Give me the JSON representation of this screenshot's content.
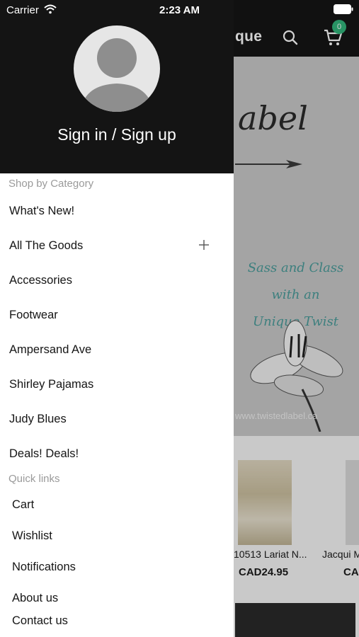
{
  "status_bar": {
    "carrier": "Carrier",
    "time": "2:23 AM"
  },
  "background_app": {
    "title_fragment": "que",
    "cart_count": "0",
    "hero": {
      "script_text": "abel",
      "tagline_lines": [
        "Sass and Class",
        "with an",
        "Unique Twist"
      ],
      "url_text": "www.twistedlabel.ca"
    },
    "products": [
      {
        "name": "10513 Lariat N...",
        "price": "CAD24.95"
      },
      {
        "name": "Jacqui M",
        "price": "CA"
      }
    ]
  },
  "drawer": {
    "sign_in_label": "Sign in / Sign up",
    "shop_section_label": "Shop by Category",
    "categories": [
      {
        "label": "What's New!"
      },
      {
        "label": "All The Goods",
        "expandable": true
      },
      {
        "label": "Accessories"
      },
      {
        "label": "Footwear"
      },
      {
        "label": "Ampersand Ave"
      },
      {
        "label": "Shirley Pajamas"
      },
      {
        "label": "Judy Blues"
      },
      {
        "label": "Deals! Deals!"
      }
    ],
    "quick_section_label": "Quick links",
    "quick_links": [
      {
        "label": "Cart"
      },
      {
        "label": "Wishlist"
      },
      {
        "label": "Notifications"
      },
      {
        "label": "About us"
      },
      {
        "label": "Contact us"
      }
    ]
  },
  "colors": {
    "header_bg": "#141414",
    "accent_badge": "#31b47a",
    "section_label": "#9a9a9a",
    "tagline": "#4a9c9a"
  },
  "icons": {
    "search": "search-icon",
    "cart": "cart-icon",
    "expand": "plus-icon",
    "avatar": "user-avatar-icon",
    "wifi": "wifi-icon",
    "battery": "battery-icon"
  }
}
